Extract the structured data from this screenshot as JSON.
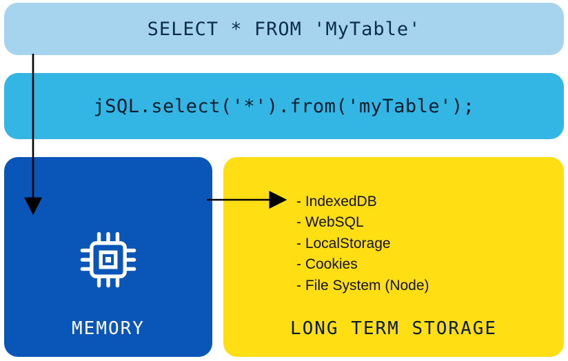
{
  "sql": {
    "text": "SELECT * FROM 'MyTable'"
  },
  "jsql": {
    "text": "jSQL.select('*').from('myTable');"
  },
  "memory": {
    "label": "MEMORY",
    "icon": "cpu-chip-icon"
  },
  "storage": {
    "label": "LONG TERM STORAGE",
    "items": [
      "IndexedDB",
      "WebSQL",
      "LocalStorage",
      "Cookies",
      "File System (Node)"
    ]
  },
  "arrows": {
    "sql_to_memory": "down-arrow",
    "memory_to_storage": "right-arrow"
  }
}
